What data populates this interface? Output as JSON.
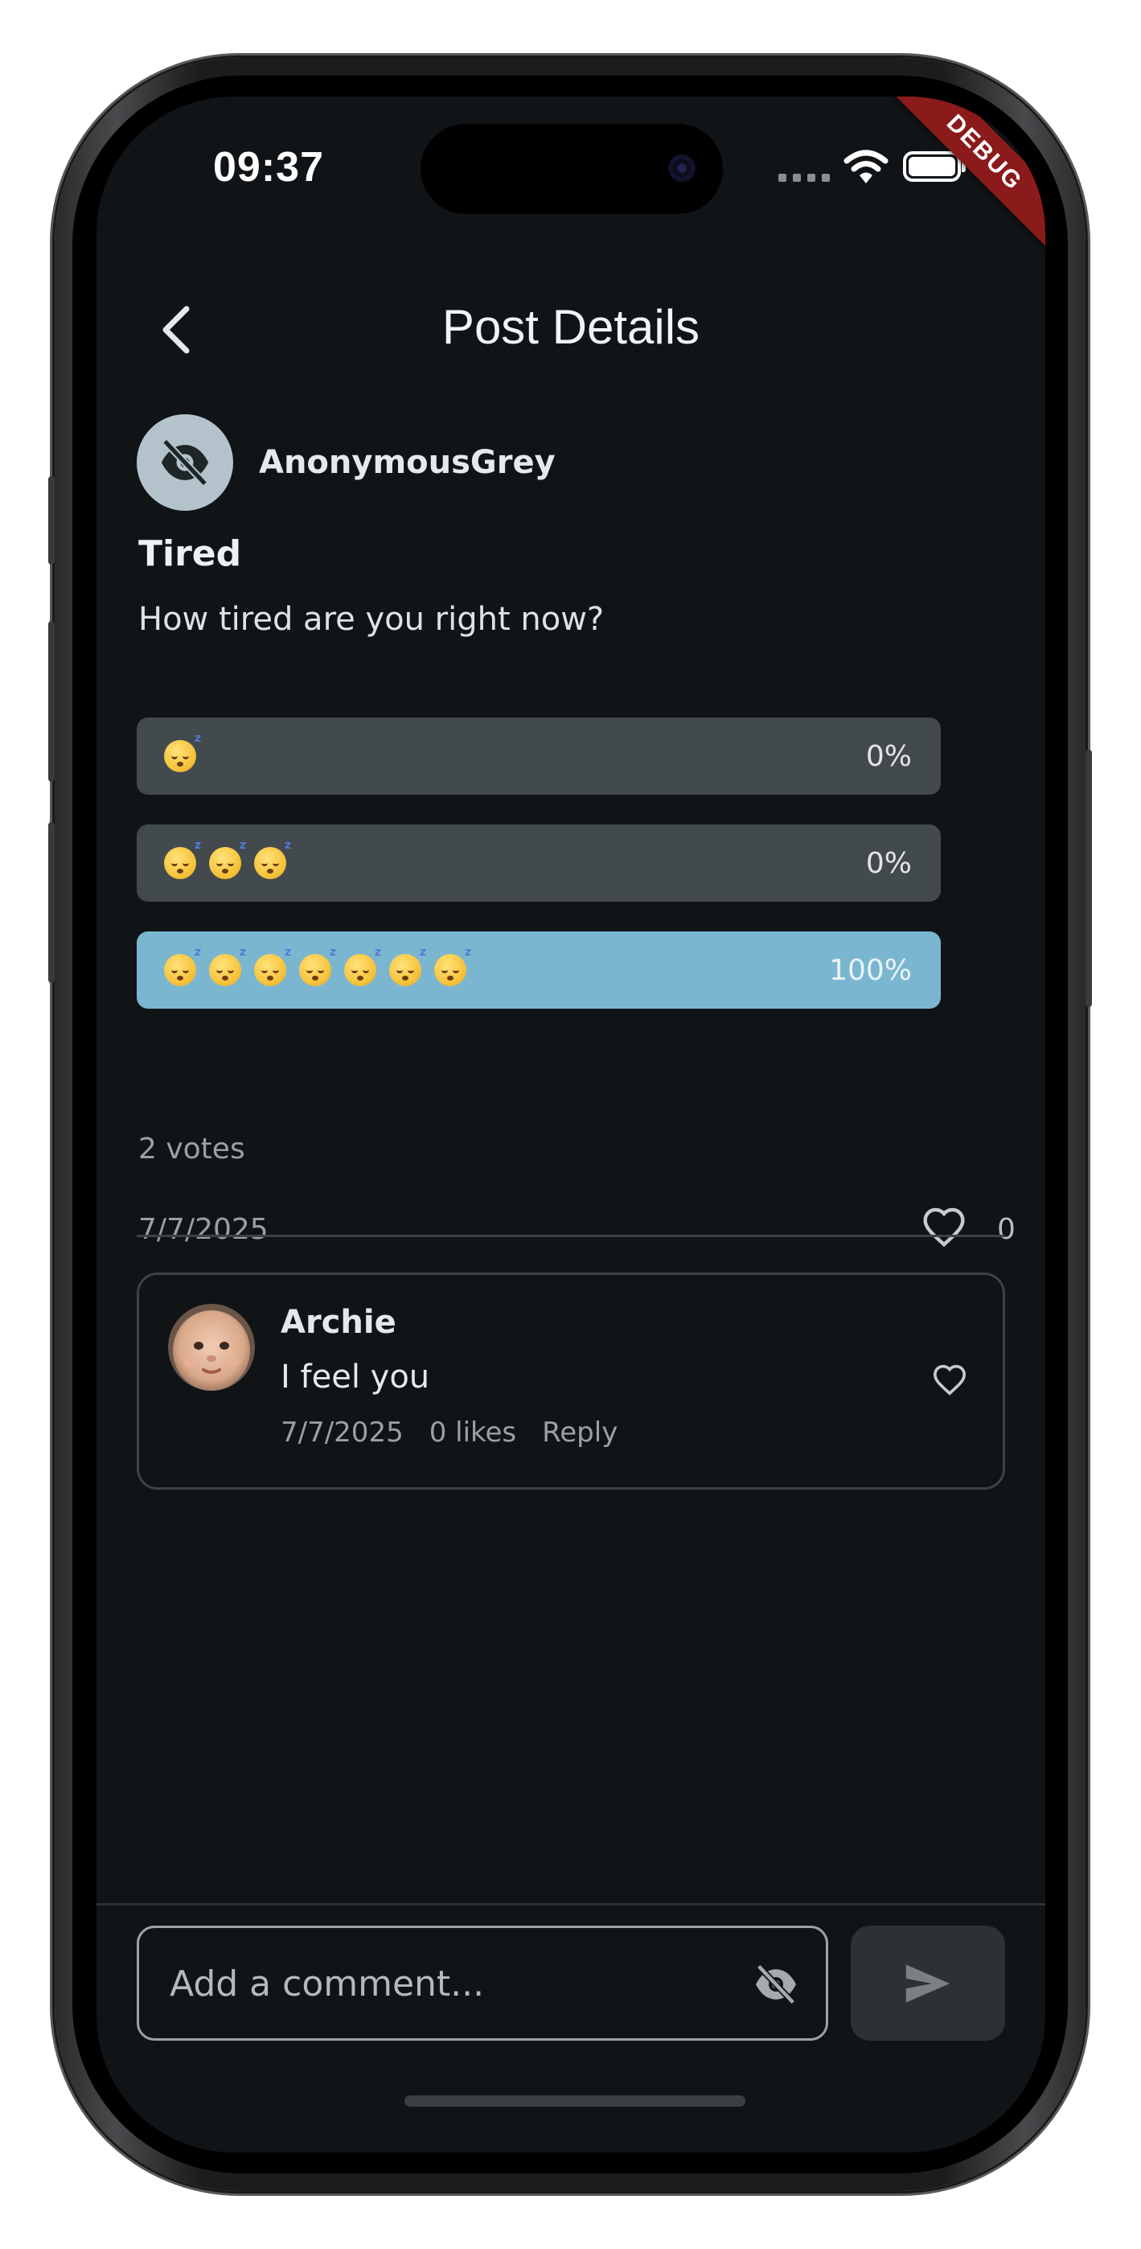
{
  "status_bar": {
    "time": "09:37",
    "icons": [
      "signal-dots-icon",
      "wifi-icon",
      "battery-icon"
    ],
    "debug_banner": "DEBUG"
  },
  "header": {
    "back_icon": "chevron-left-icon",
    "title": "Post Details"
  },
  "post": {
    "author": "AnonymousGrey",
    "avatar_icon": "eye-off-icon",
    "title": "Tired",
    "body": "How tired are you right now?",
    "poll": {
      "options": [
        {
          "emoji_count": 1,
          "emoji": "sleeping-face-emoji",
          "percent_label": "0%",
          "fraction": 0.0
        },
        {
          "emoji_count": 3,
          "emoji": "sleeping-face-emoji",
          "percent_label": "0%",
          "fraction": 0.0
        },
        {
          "emoji_count": 7,
          "emoji": "sleeping-face-emoji",
          "percent_label": "100%",
          "fraction": 1.0
        }
      ],
      "votes_label": "2 votes"
    },
    "date": "7/7/2025",
    "like_icon": "heart-outline-icon",
    "like_count": "0"
  },
  "comments": [
    {
      "author": "Archie",
      "text": "I feel you",
      "date": "7/7/2025",
      "likes_label": "0 likes",
      "reply_label": "Reply",
      "like_icon": "heart-outline-icon"
    }
  ],
  "composer": {
    "placeholder": "Add a comment...",
    "value": "",
    "anon_icon": "eye-off-icon",
    "send_icon": "send-icon"
  },
  "colors": {
    "background": "#101417",
    "poll_bar": "#434a4e",
    "poll_fill": "#7bb6d0",
    "avatar_bg": "#b4c3cb",
    "debug_banner": "#8b1a1a"
  }
}
